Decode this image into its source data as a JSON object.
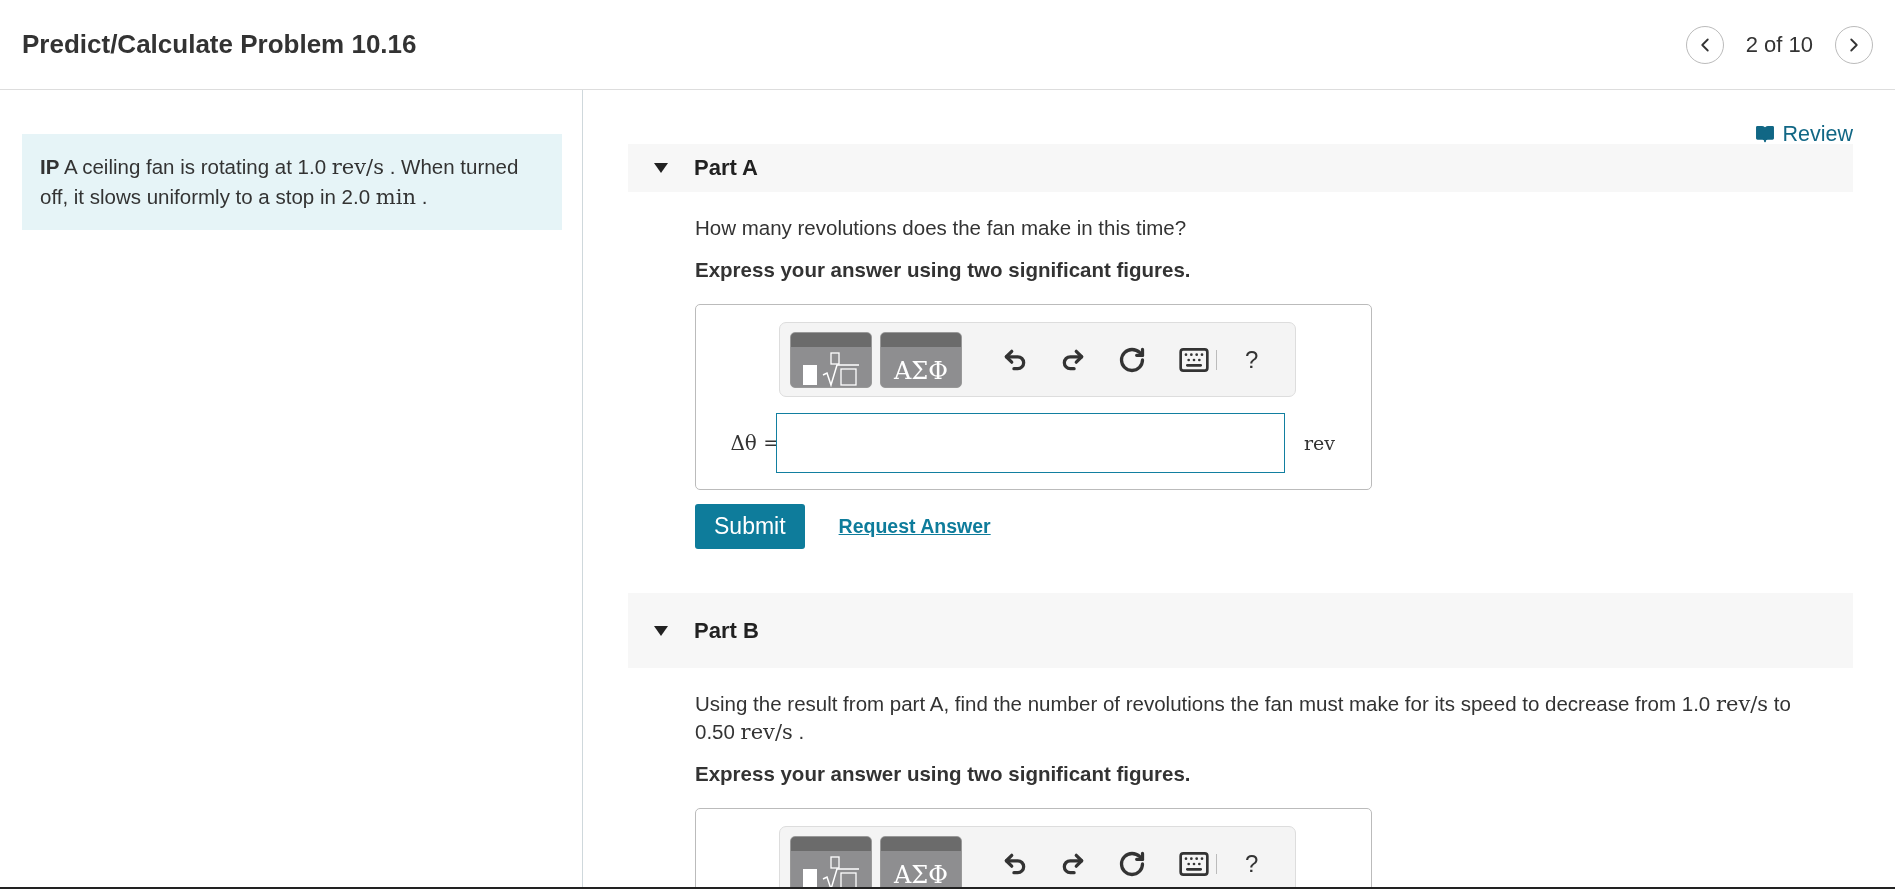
{
  "header": {
    "title": "Predict/Calculate Problem 10.16",
    "position": "2 of 10"
  },
  "problem": {
    "segments": [
      {
        "kind": "text",
        "text": "**IP** A ceiling fan is rotating at 1.0"
      },
      {
        "kind": "math",
        "text": "rev/s"
      },
      {
        "kind": "text",
        "text": ". When turned off, it slows uniformly to a stop in 2.0"
      },
      {
        "kind": "math",
        "text": "min"
      },
      {
        "kind": "text",
        "text": "."
      }
    ]
  },
  "review": {
    "label": "Review"
  },
  "parts": [
    {
      "title": "Part A",
      "expanded": true,
      "question": [
        {
          "kind": "text",
          "text": "How many revolutions does the fan make in this time?"
        }
      ],
      "instruction": "Express your answer using two significant figures.",
      "toolbar": {
        "greek": "ΑΣΦ",
        "help": "?"
      },
      "answer": {
        "label": "Δθ =",
        "unit": "rev",
        "submit": "Submit",
        "request": "Request Answer"
      }
    },
    {
      "title": "Part B",
      "expanded": true,
      "question": [
        {
          "kind": "text",
          "text": "Using the result from part A, find the number of revolutions the fan must make for its speed to decrease from 1.0"
        },
        {
          "kind": "math",
          "text": "rev/s"
        },
        {
          "kind": "text",
          "text": "to 0.50"
        },
        {
          "kind": "math",
          "text": "rev/s"
        },
        {
          "kind": "text",
          "text": "."
        }
      ],
      "instruction": "Express your answer using two significant figures.",
      "toolbar": {
        "greek": "ΑΣΦ",
        "help": "?"
      }
    }
  ]
}
